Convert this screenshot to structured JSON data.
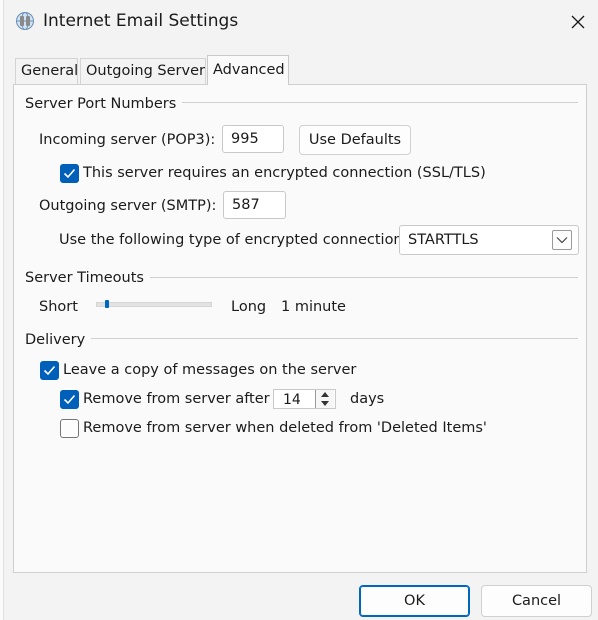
{
  "window": {
    "title": "Internet Email Settings",
    "app_icon": "email-globe-icon",
    "close_icon": "close-icon"
  },
  "tabs": [
    {
      "label": "General",
      "selected": false
    },
    {
      "label": "Outgoing Server",
      "selected": false
    },
    {
      "label": "Advanced",
      "selected": true
    }
  ],
  "server_ports": {
    "group_title": "Server Port Numbers",
    "incoming_label": "Incoming server (POP3):",
    "incoming_value": "995",
    "use_defaults_label": "Use Defaults",
    "ssl_checkbox_label": "This server requires an encrypted connection (SSL/TLS)",
    "ssl_checked": true,
    "outgoing_label": "Outgoing server (SMTP):",
    "outgoing_value": "587",
    "encryption_label": "Use the following type of encrypted connection:",
    "encryption_value": "STARTTLS"
  },
  "timeouts": {
    "group_title": "Server Timeouts",
    "short_label": "Short",
    "long_label": "Long",
    "timeout_value": "1 minute",
    "slider_level": 0.08
  },
  "delivery": {
    "group_title": "Delivery",
    "leave_copy_label": "Leave a copy of messages on the server",
    "leave_copy_checked": true,
    "remove_after_label": "Remove from server after",
    "remove_after_checked": true,
    "remove_after_days": "14",
    "days_label": "days",
    "remove_deleted_label": "Remove from server when deleted from 'Deleted Items'",
    "remove_deleted_checked": false
  },
  "footer": {
    "ok_label": "OK",
    "cancel_label": "Cancel"
  },
  "colors": {
    "accent": "#005fb8",
    "background": "#f3f3f3",
    "panel": "#fafafa"
  }
}
